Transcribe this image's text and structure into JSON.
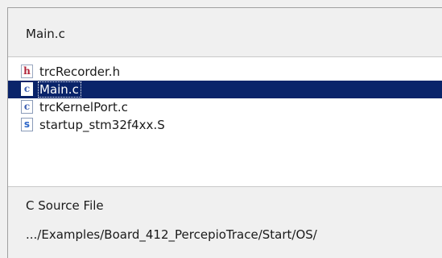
{
  "header": {
    "title": "Main.c"
  },
  "files": [
    {
      "name": "trcRecorder.h",
      "icon_letter": "h",
      "icon": "h-header-file-icon",
      "selected": false
    },
    {
      "name": "Main.c",
      "icon_letter": "c",
      "icon": "c-source-file-icon",
      "selected": true
    },
    {
      "name": "trcKernelPort.c",
      "icon_letter": "c",
      "icon": "c-source-file-icon",
      "selected": false
    },
    {
      "name": "startup_stm32f4xx.S",
      "icon_letter": "s",
      "icon": "assembly-file-icon",
      "selected": false
    }
  ],
  "footer": {
    "file_type": "C Source File",
    "path": ".../Examples/Board_412_PercepioTrace/Start/OS/"
  },
  "colors": {
    "selection": "#0a246a",
    "list_background": "#ffffff",
    "panel_background": "#f0f0f0"
  }
}
